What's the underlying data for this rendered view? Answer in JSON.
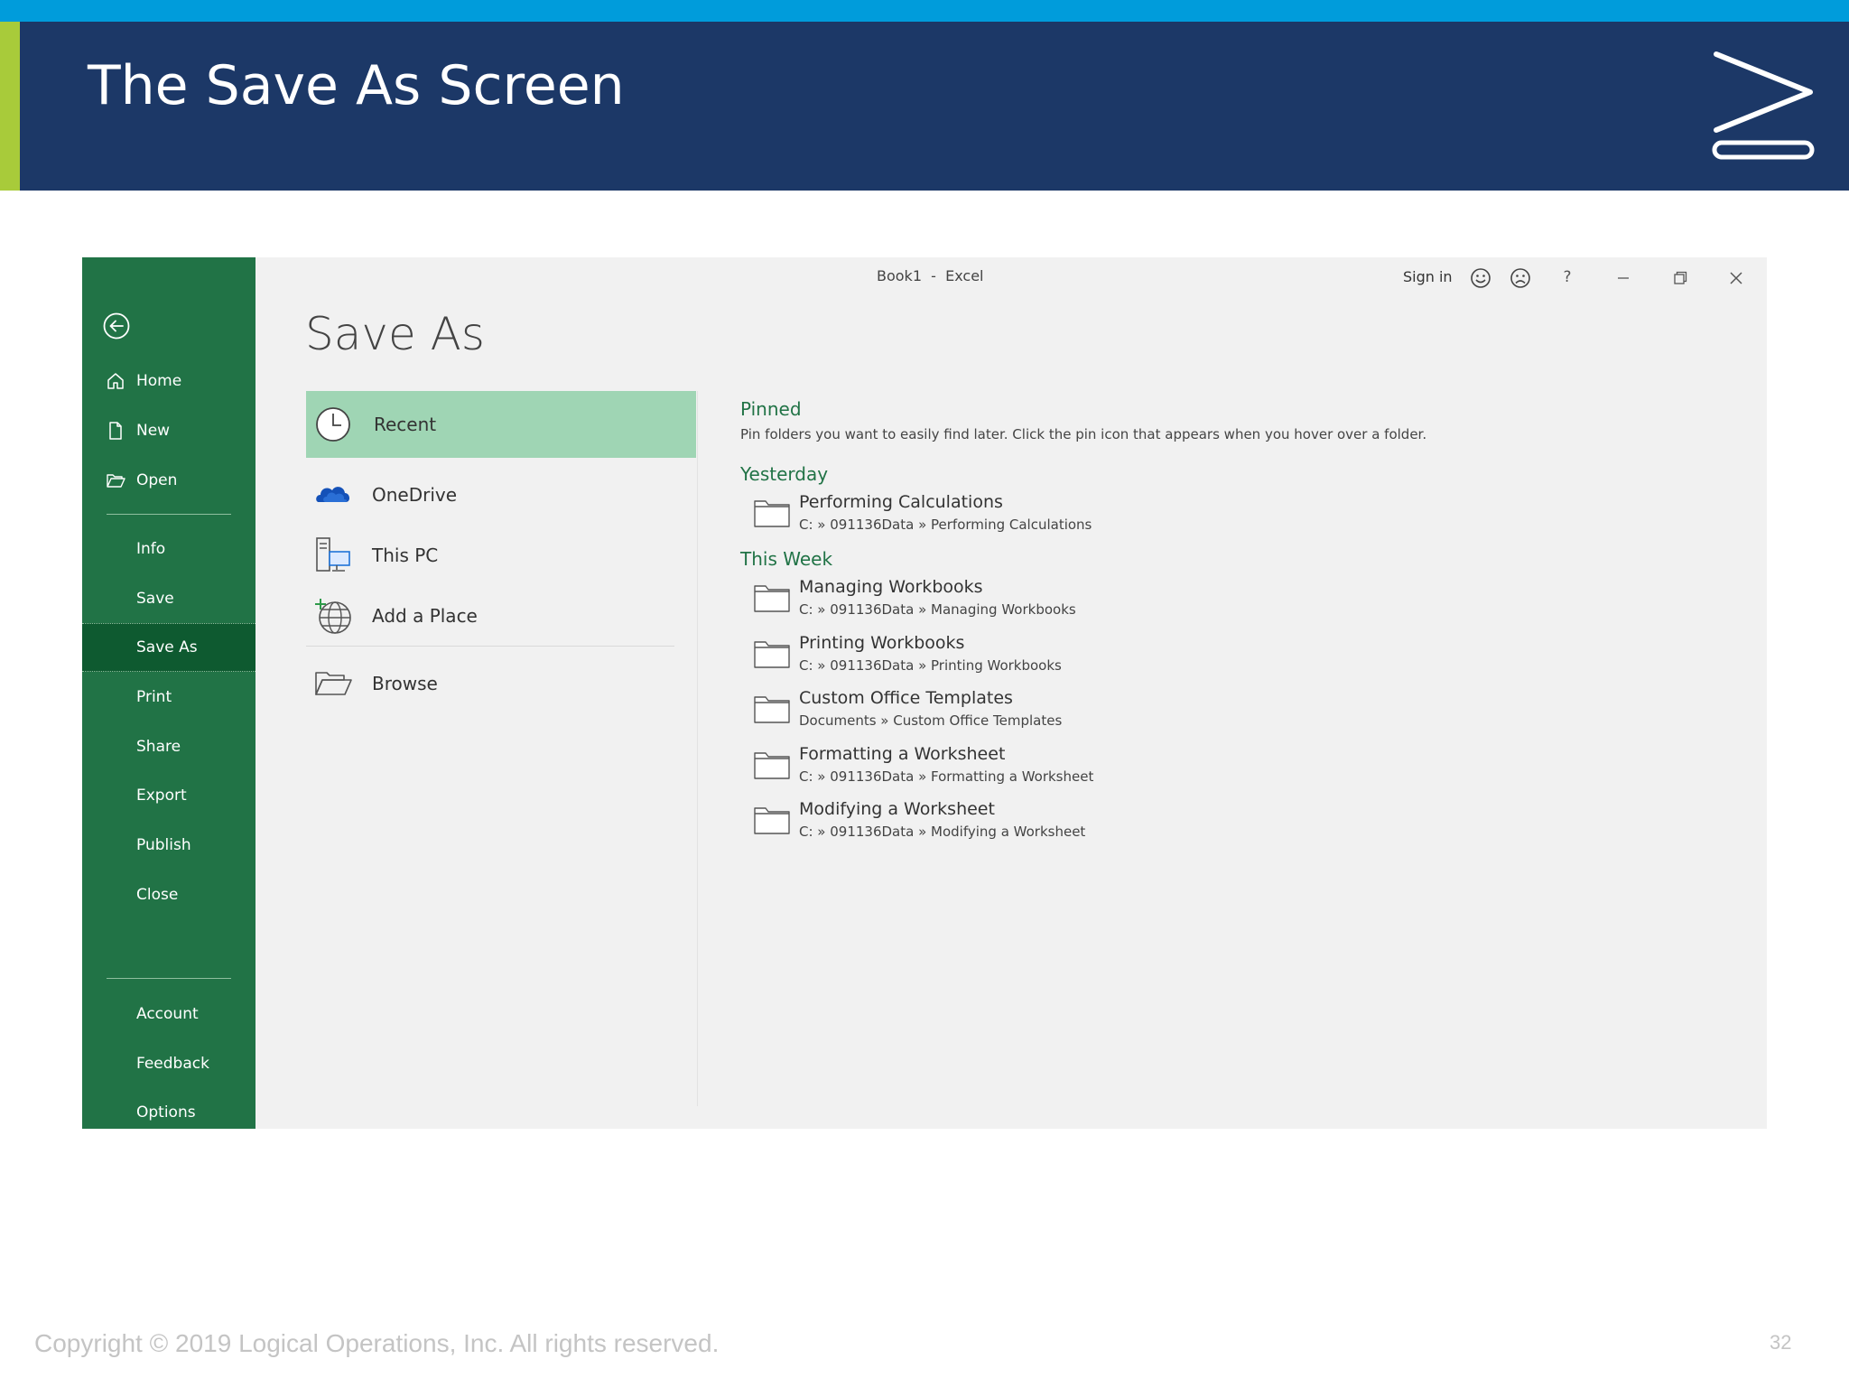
{
  "slide": {
    "title": "The Save As Screen",
    "copyright": "Copyright © 2019 Logical Operations, Inc. All rights reserved.",
    "page_number": "32",
    "colors": {
      "header_bg": "#1c3867",
      "top_stripe": "#009cdb",
      "accent_bar": "#a8cb3a"
    }
  },
  "window": {
    "title": "Book1  -  Excel",
    "sign_in": "Sign in",
    "controls": [
      "smiley-icon",
      "frown-icon",
      "help-icon",
      "minimize-icon",
      "restore-icon",
      "close-icon"
    ],
    "help_label": "?"
  },
  "sidebar": {
    "back_icon": "back-arrow-icon",
    "items": [
      {
        "label": "Home",
        "icon": "home-icon"
      },
      {
        "label": "New",
        "icon": "new-document-icon"
      },
      {
        "label": "Open",
        "icon": "open-folder-icon"
      },
      {
        "label": "Info"
      },
      {
        "label": "Save"
      },
      {
        "label": "Save As",
        "active": true
      },
      {
        "label": "Print"
      },
      {
        "label": "Share"
      },
      {
        "label": "Export"
      },
      {
        "label": "Publish"
      },
      {
        "label": "Close"
      },
      {
        "label": "Account"
      },
      {
        "label": "Feedback"
      },
      {
        "label": "Options"
      }
    ],
    "colors": {
      "bg": "#217346",
      "active_bg": "#0e5a30"
    }
  },
  "main": {
    "heading": "Save As",
    "locations": [
      {
        "label": "Recent",
        "icon": "clock-icon",
        "selected": true
      },
      {
        "label": "OneDrive",
        "icon": "cloud-icon"
      },
      {
        "label": "This PC",
        "icon": "computer-icon"
      },
      {
        "label": "Add a Place",
        "icon": "globe-add-icon"
      },
      {
        "label": "Browse",
        "icon": "open-folder-icon"
      }
    ],
    "pinned": {
      "heading": "Pinned",
      "description": "Pin folders you want to easily find later. Click the pin icon that appears when you hover over a folder."
    },
    "yesterday": {
      "heading": "Yesterday",
      "folders": [
        {
          "name": "Performing Calculations",
          "path": "C: » 091136Data » Performing Calculations"
        }
      ]
    },
    "this_week": {
      "heading": "This Week",
      "folders": [
        {
          "name": "Managing Workbooks",
          "path": "C: » 091136Data » Managing Workbooks"
        },
        {
          "name": "Printing Workbooks",
          "path": "C: » 091136Data » Printing Workbooks"
        },
        {
          "name": "Custom Office Templates",
          "path": "Documents » Custom Office Templates"
        },
        {
          "name": "Formatting a Worksheet",
          "path": "C: » 091136Data » Formatting a Worksheet"
        },
        {
          "name": "Modifying a Worksheet",
          "path": "C: » 091136Data » Modifying a Worksheet"
        }
      ]
    },
    "colors": {
      "selected_bg": "#9fd5b4",
      "section_heading": "#217346"
    }
  }
}
